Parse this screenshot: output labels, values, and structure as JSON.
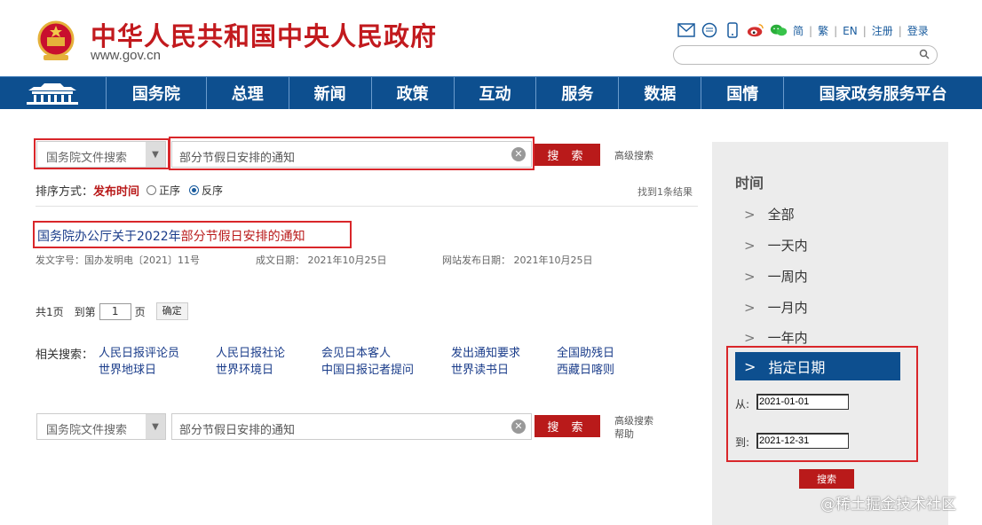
{
  "header": {
    "site_title": "中华人民共和国中央人民政府",
    "site_url": "www.gov.cn",
    "icons": [
      "mail-icon",
      "message-icon",
      "mobile-icon",
      "weibo-icon",
      "wechat-icon"
    ],
    "lang_links": [
      "简",
      "繁",
      "EN",
      "注册",
      "登录"
    ],
    "search_placeholder": ""
  },
  "nav": {
    "items": [
      "国务院",
      "总理",
      "新闻",
      "政策",
      "互动",
      "服务",
      "数据",
      "国情",
      "国家政务服务平台"
    ]
  },
  "search": {
    "category": "国务院文件搜索",
    "query": "部分节假日安排的通知",
    "button": "搜 索",
    "advanced": "高级搜索"
  },
  "sort": {
    "label": "排序方式：",
    "current": "发布时间",
    "options": [
      "正序",
      "反序"
    ],
    "selected": "反序",
    "result_count": "找到1条结果"
  },
  "results": [
    {
      "title_prefix": "国务院办公厅关于2022年",
      "title_highlight": "部分节假日安排的通知",
      "doc_no": "发文字号：国办发明电〔2021〕11号",
      "created": "成文日期：  2021年10月25日",
      "published": "网站发布日期：  2021年10月25日"
    }
  ],
  "pagination": {
    "total": "共1页",
    "goto_label": "到第",
    "page_value": "1",
    "page_unit": "页",
    "confirm": "确定"
  },
  "related": {
    "label": "相关搜索：",
    "col1": [
      "人民日报评论员",
      "世界地球日"
    ],
    "col2": [
      "人民日报社论",
      "世界环境日"
    ],
    "col3": [
      "会见日本客人",
      "中国日报记者提问"
    ],
    "col4": [
      "发出通知要求",
      "世界读书日"
    ],
    "col5": [
      "全国助残日",
      "西藏日喀则"
    ]
  },
  "bottom_search": {
    "category": "国务院文件搜索",
    "query": "部分节假日安排的通知",
    "button": "搜 索",
    "advanced": "高级搜索",
    "help": "帮助"
  },
  "sidebar": {
    "title": "时间",
    "items": [
      "全部",
      "一天内",
      "一周内",
      "一月内",
      "一年内"
    ],
    "custom_label": "指定日期",
    "from_label": "从:",
    "from_value": "2021-01-01",
    "to_label": "到:",
    "to_value": "2021-12-31",
    "search_button": "搜索"
  },
  "watermark": "@稀土掘金技术社区",
  "colors": {
    "brand_red": "#c21a1e",
    "nav_blue": "#0d4f8f",
    "highlight_frame": "#d9262a"
  }
}
